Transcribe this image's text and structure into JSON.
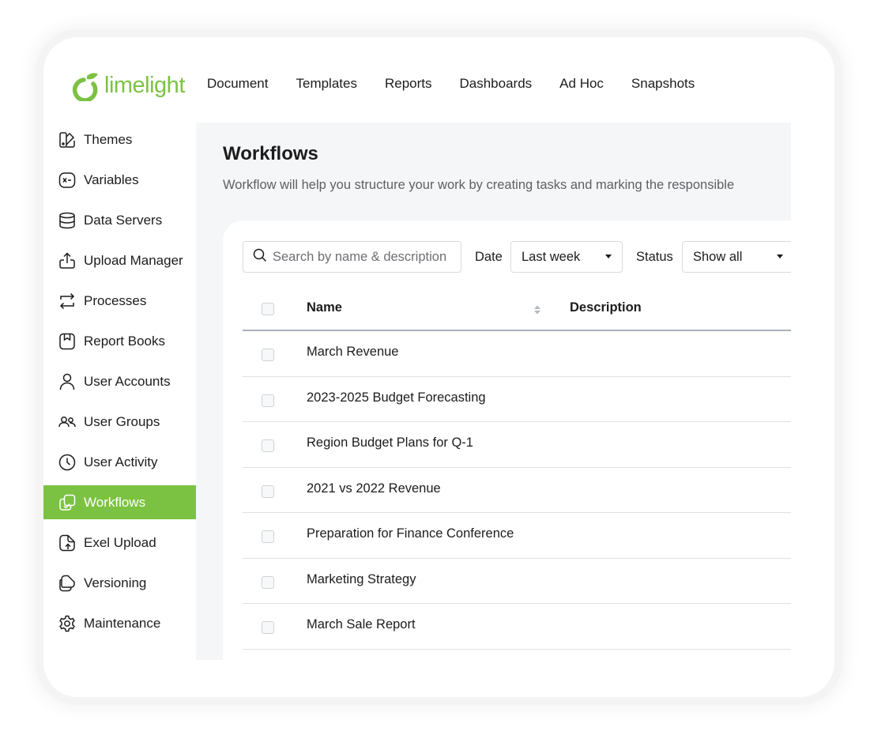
{
  "app": {
    "logo_text": "limelight",
    "brand_color": "#7cc242"
  },
  "topnav": {
    "items": [
      {
        "label": "Document"
      },
      {
        "label": "Templates"
      },
      {
        "label": "Reports"
      },
      {
        "label": "Dashboards"
      },
      {
        "label": "Ad Hoc"
      },
      {
        "label": "Snapshots"
      }
    ]
  },
  "sidebar": {
    "active": "Workflows",
    "items": [
      {
        "label": "Themes",
        "icon": "themes-icon"
      },
      {
        "label": "Variables",
        "icon": "variables-icon"
      },
      {
        "label": "Data Servers",
        "icon": "database-icon"
      },
      {
        "label": "Upload Manager",
        "icon": "upload-icon"
      },
      {
        "label": "Processes",
        "icon": "processes-icon"
      },
      {
        "label": "Report Books",
        "icon": "report-book-icon"
      },
      {
        "label": "User Accounts",
        "icon": "user-icon"
      },
      {
        "label": "User Groups",
        "icon": "user-group-icon"
      },
      {
        "label": "User Activity",
        "icon": "clock-icon"
      },
      {
        "label": "Workflows",
        "icon": "workflow-icon"
      },
      {
        "label": "Exel Upload",
        "icon": "excel-upload-icon"
      },
      {
        "label": "Versioning",
        "icon": "versioning-icon"
      },
      {
        "label": "Maintenance",
        "icon": "gear-icon"
      }
    ]
  },
  "main": {
    "title": "Workflows",
    "subtitle": "Workflow will help you structure your work by creating tasks and marking the responsible",
    "search": {
      "placeholder": "Search by name & description",
      "icon": "search-icon"
    },
    "filters": {
      "date_label": "Date",
      "date_value": "Last week",
      "status_label": "Status",
      "status_value": "Show all"
    },
    "table": {
      "columns": [
        "Name",
        "Description"
      ],
      "rows": [
        {
          "name": "March Revenue",
          "description": ""
        },
        {
          "name": "2023-2025 Budget Forecasting",
          "description": ""
        },
        {
          "name": "Region Budget Plans for Q-1",
          "description": ""
        },
        {
          "name": "2021 vs 2022 Revenue",
          "description": ""
        },
        {
          "name": "Preparation for Finance Conference",
          "description": ""
        },
        {
          "name": "Marketing Strategy",
          "description": ""
        },
        {
          "name": "March Sale Report",
          "description": ""
        }
      ]
    }
  }
}
